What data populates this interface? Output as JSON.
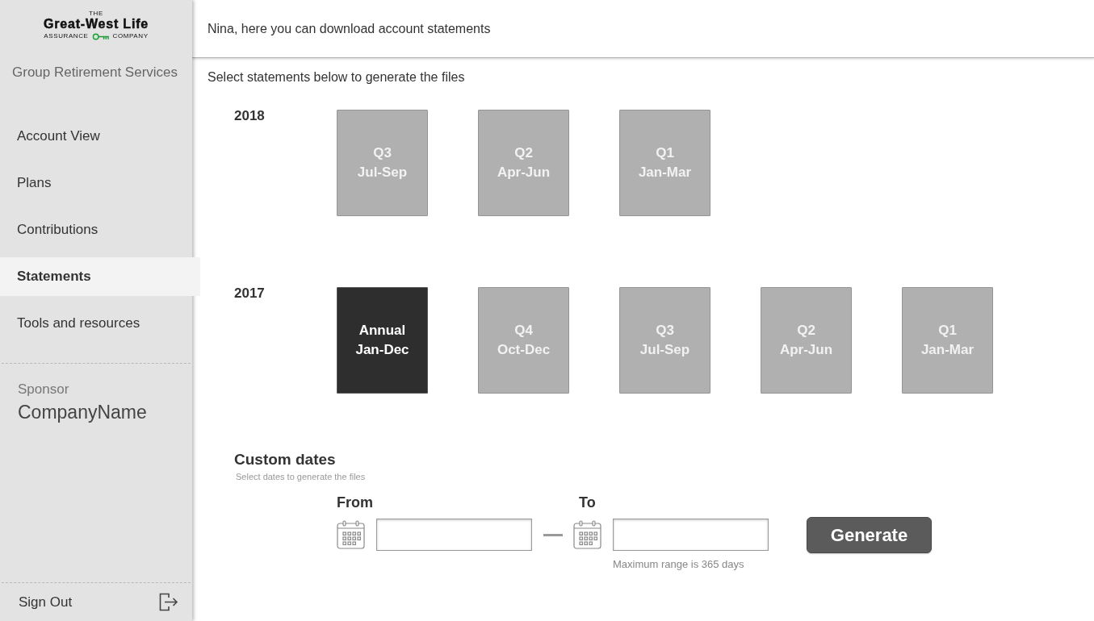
{
  "sidebar": {
    "logo": {
      "top": "THE",
      "name": "Great-West Life",
      "left": "ASSURANCE",
      "right": "COMPANY"
    },
    "subtitle": "Group Retirement Services",
    "nav_items": [
      {
        "label": "Account View",
        "selected": false
      },
      {
        "label": "Plans",
        "selected": false
      },
      {
        "label": "Contributions",
        "selected": false
      },
      {
        "label": "Statements",
        "selected": true
      },
      {
        "label": "Tools and resources",
        "selected": false
      }
    ],
    "sponsor": {
      "label": "Sponsor",
      "name": "CompanyName"
    },
    "sign_out": "Sign Out"
  },
  "header": {
    "title": "Nina, here you can download account statements"
  },
  "instructions": "Select statements below to generate the files",
  "years": [
    {
      "year": "2018",
      "statements": [
        {
          "label": "Q3",
          "range": "Jul-Sep",
          "selected": false
        },
        {
          "label": "Q2",
          "range": "Apr-Jun",
          "selected": false
        },
        {
          "label": "Q1",
          "range": "Jan-Mar",
          "selected": false
        }
      ]
    },
    {
      "year": "2017",
      "statements": [
        {
          "label": "Annual",
          "range": "Jan-Dec",
          "selected": true
        },
        {
          "label": "Q4",
          "range": "Oct-Dec",
          "selected": false
        },
        {
          "label": "Q3",
          "range": "Jul-Sep",
          "selected": false
        },
        {
          "label": "Q2",
          "range": "Apr-Jun",
          "selected": false
        },
        {
          "label": "Q1",
          "range": "Jan-Mar",
          "selected": false
        }
      ]
    }
  ],
  "custom_dates": {
    "title": "Custom dates",
    "subtitle": "Select dates to generate the files",
    "from": {
      "label": "From"
    },
    "to": {
      "label": "To",
      "hint": "Maximum range is 365 days"
    },
    "button": "Generate"
  }
}
